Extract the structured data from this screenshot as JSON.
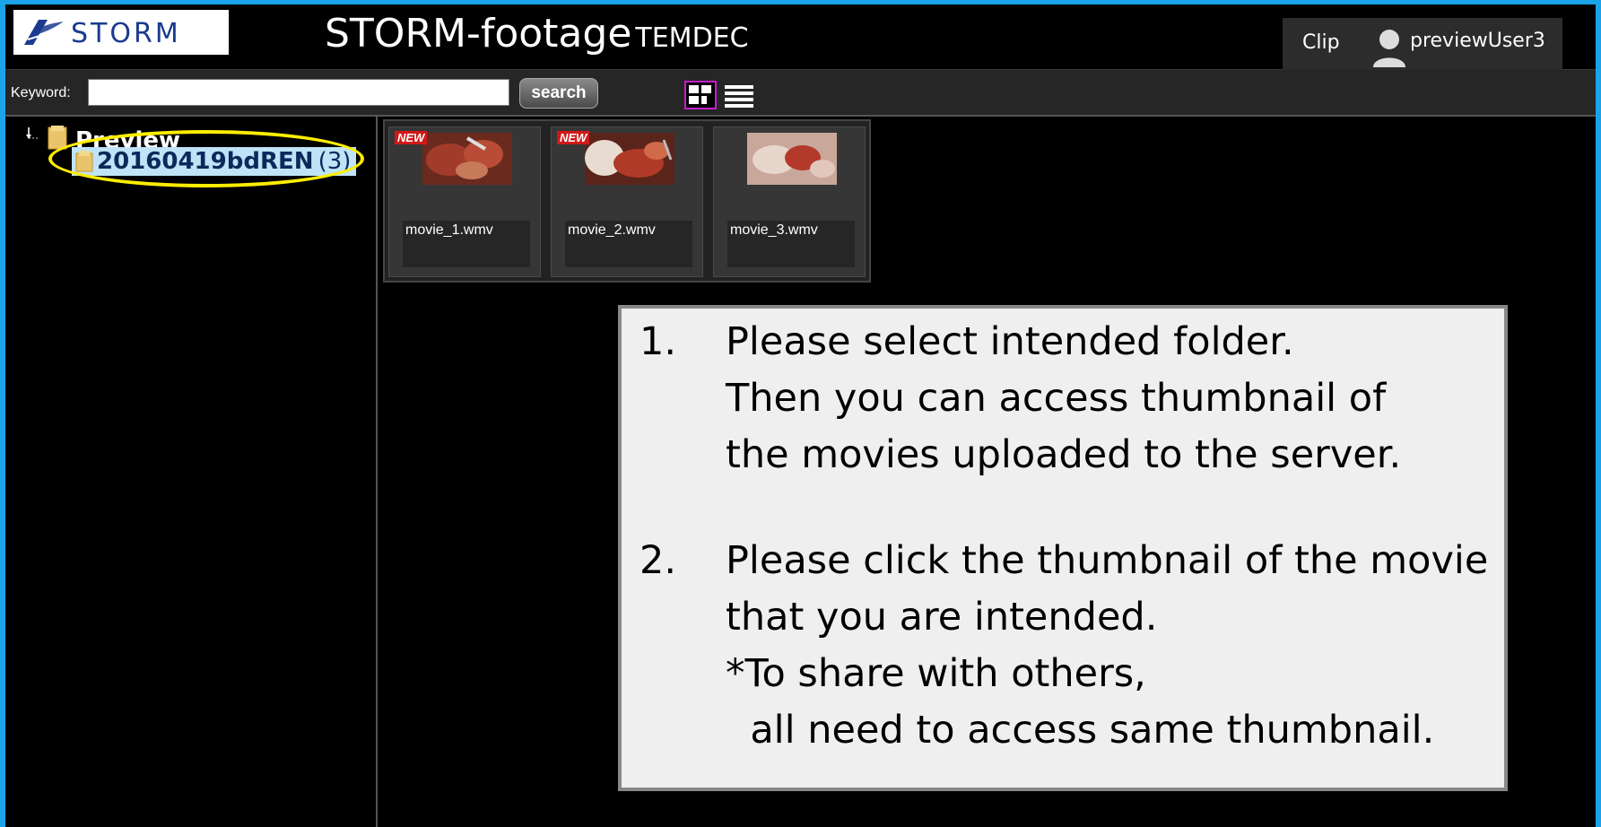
{
  "header": {
    "logo_text": "STORM",
    "app_title": "STORM-footage",
    "app_subtitle": "TEMDEC",
    "clip_label": "Clip",
    "user_name": "previewUser3"
  },
  "toolbar": {
    "keyword_label": "Keyword:",
    "search_value": "",
    "search_button": "search"
  },
  "tree": {
    "root_label": "Preview",
    "child_label": "20160419bdREN",
    "child_count": "(3)"
  },
  "thumbnails": [
    {
      "name": "movie_1.wmv",
      "badge": "NEW"
    },
    {
      "name": "movie_2.wmv",
      "badge": "NEW"
    },
    {
      "name": "movie_3.wmv",
      "badge": ""
    }
  ],
  "instructions": {
    "step1_num": "1.",
    "step1_lines": [
      "Please select intended folder.",
      "Then you can access thumbnail of",
      "the movies uploaded to the server."
    ],
    "step2_num": "2.",
    "step2_lines": [
      "Please click the thumbnail of the movie",
      "that you are intended.",
      "*To share with others,",
      "  all need to access same thumbnail."
    ]
  },
  "colors": {
    "frame_border": "#1aa3e8",
    "highlight": "#ffee00",
    "view_selected": "#c71ec9",
    "new_badge": "#d11818"
  }
}
